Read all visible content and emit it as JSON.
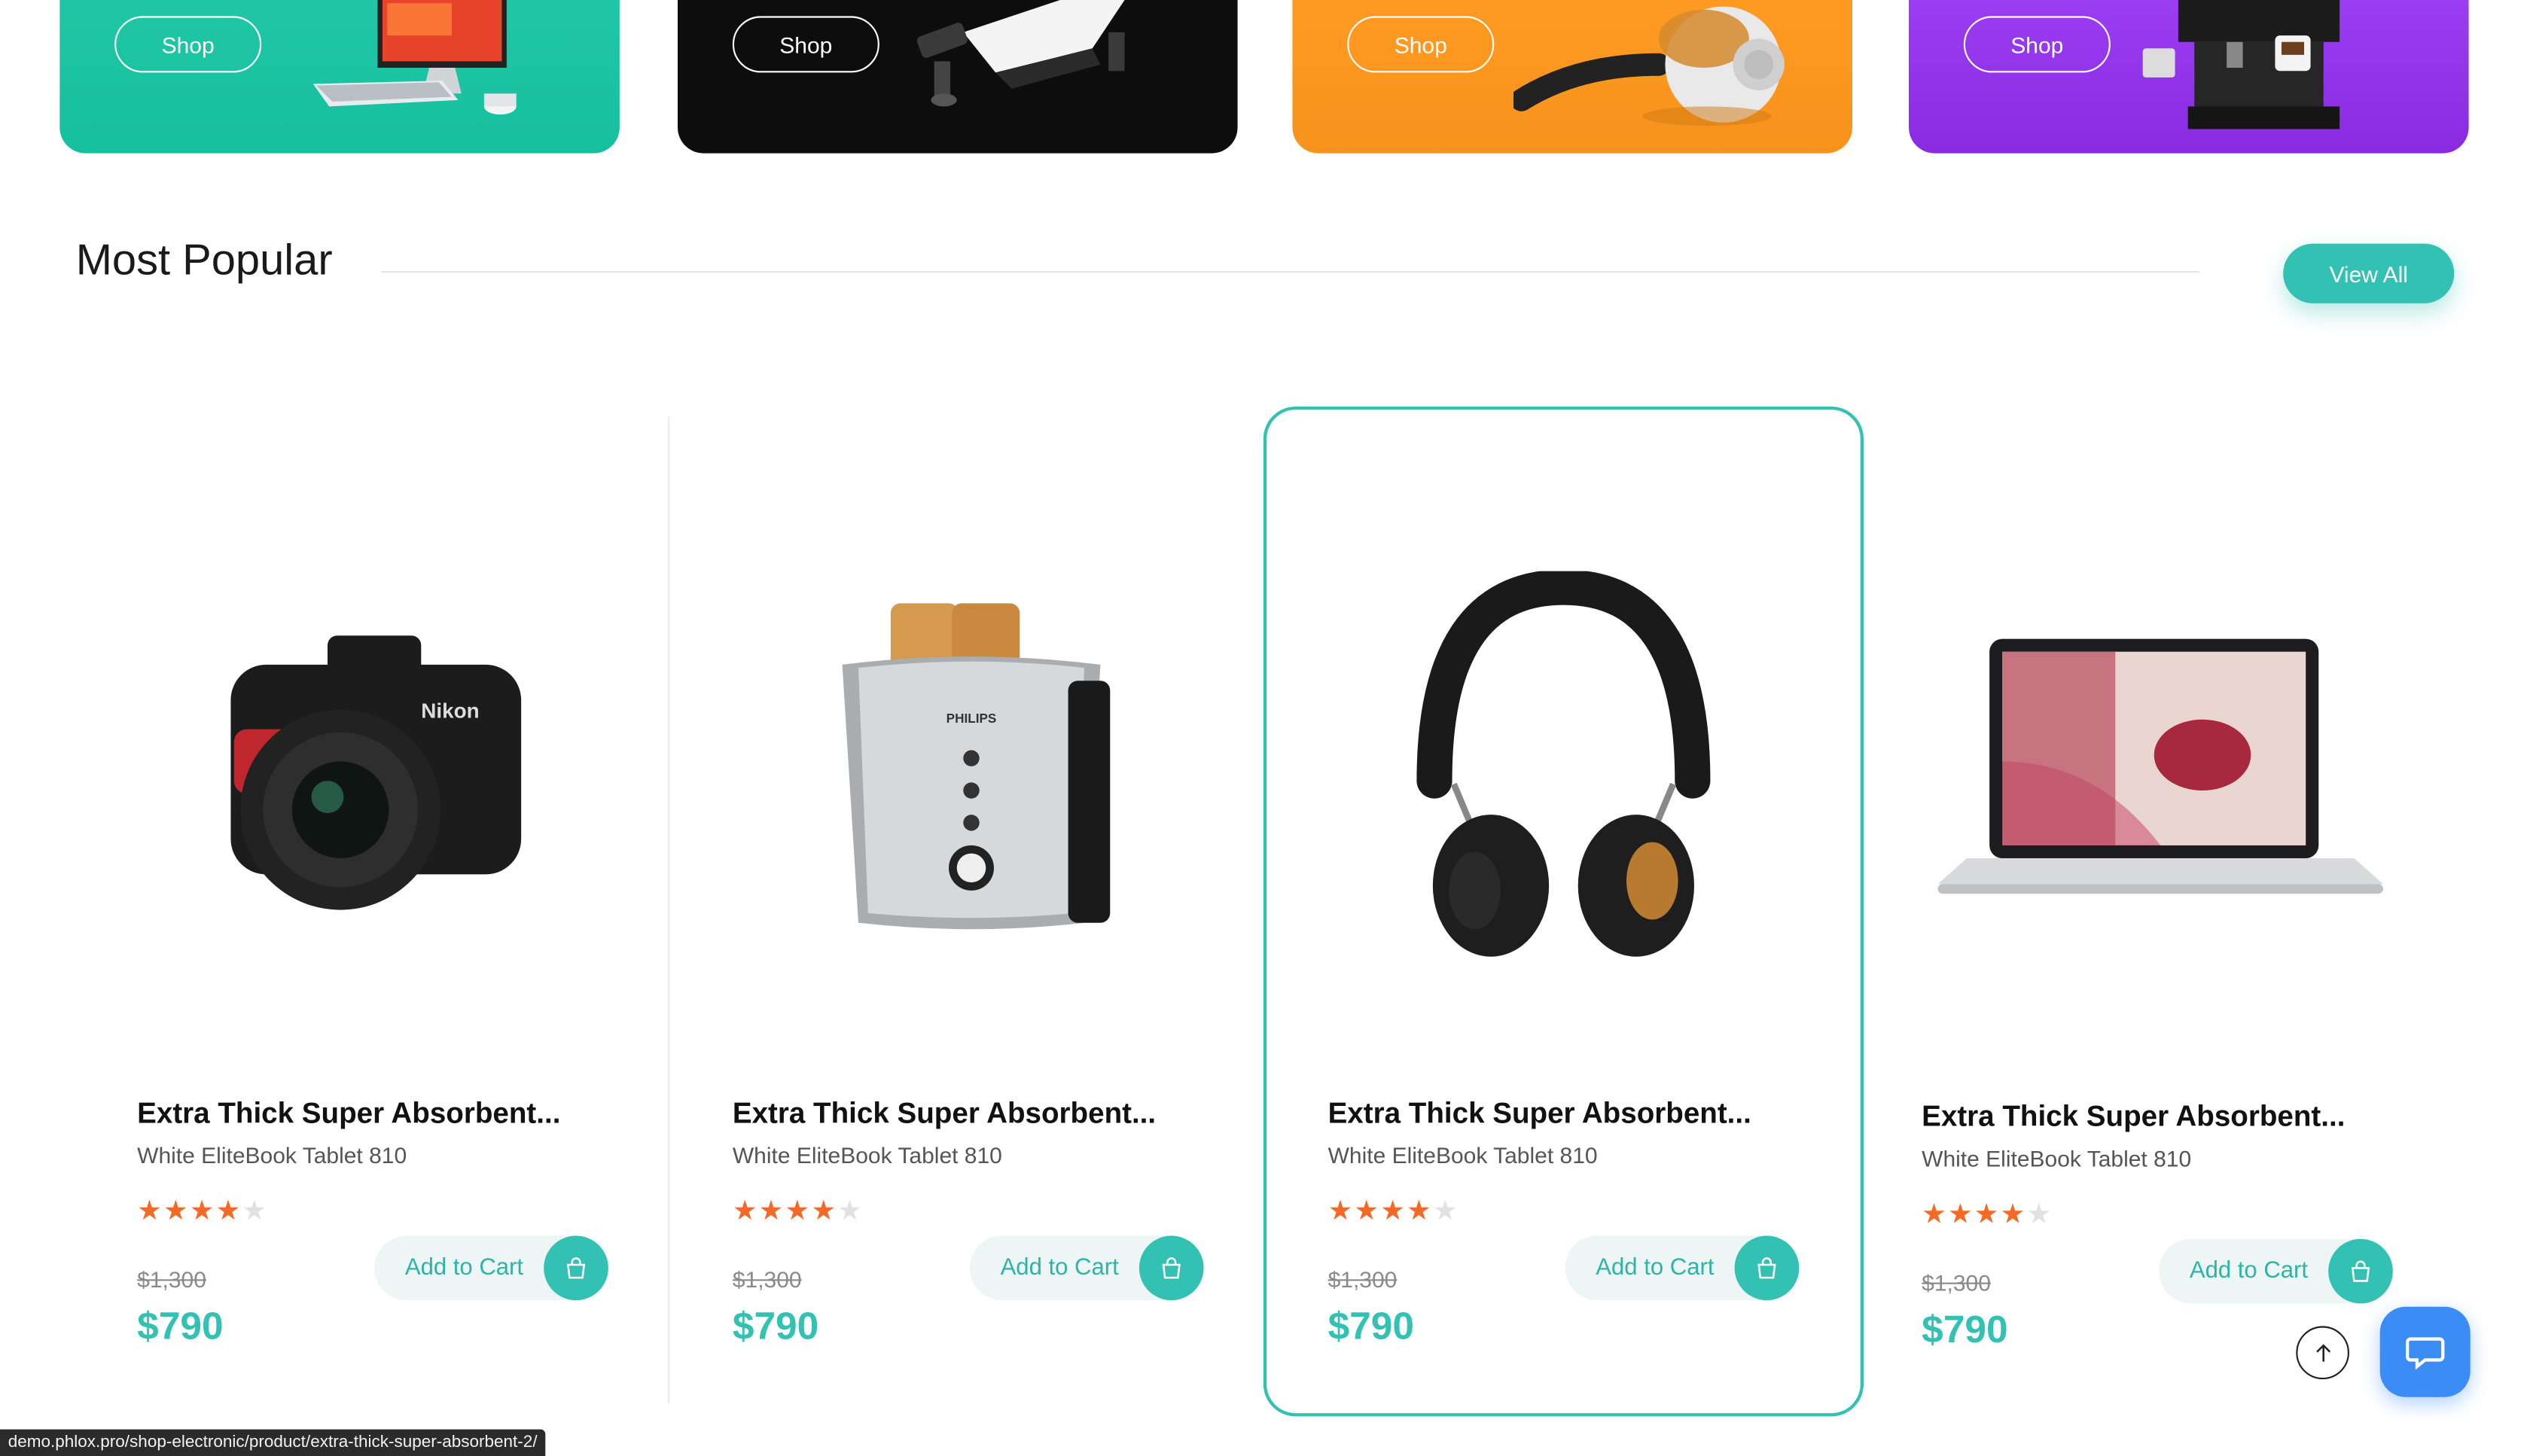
{
  "banners": [
    {
      "button_label": "Shop",
      "color": "#1fc7a6",
      "art": "desktop-computer"
    },
    {
      "button_label": "Shop",
      "color": "#0d0d0d",
      "art": "drone"
    },
    {
      "button_label": "Shop",
      "color": "#f7931c",
      "art": "vacuum-cleaner"
    },
    {
      "button_label": "Shop",
      "color": "#8a2be2",
      "art": "coffee-machine"
    }
  ],
  "section": {
    "title": "Most Popular",
    "view_all_label": "View All"
  },
  "products": [
    {
      "title": "Extra Thick Super Absorbent...",
      "subtitle": "White EliteBook Tablet 810",
      "rating": 4,
      "rating_max": 5,
      "old_price": "$1,300",
      "price": "$790",
      "cart_label": "Add to Cart",
      "image": "nikon-camera"
    },
    {
      "title": "Extra Thick Super Absorbent...",
      "subtitle": "White EliteBook Tablet 810",
      "rating": 4,
      "rating_max": 5,
      "old_price": "$1,300",
      "price": "$790",
      "cart_label": "Add to Cart",
      "image": "philips-toaster",
      "brand_text": "PHILIPS"
    },
    {
      "title": "Extra Thick Super Absorbent...",
      "subtitle": "White EliteBook Tablet 810",
      "rating": 4,
      "rating_max": 5,
      "old_price": "$1,300",
      "price": "$790",
      "cart_label": "Add to Cart",
      "image": "headphones",
      "highlighted": true
    },
    {
      "title": "Extra Thick Super Absorbent...",
      "subtitle": "White EliteBook Tablet 810",
      "rating": 4,
      "rating_max": 5,
      "old_price": "$1,300",
      "price": "$790",
      "cart_label": "Add to Cart",
      "image": "laptop"
    }
  ],
  "camera_brand": "Nikon",
  "icons": {
    "cart": "shopping-bag-icon",
    "scroll_top": "arrow-up-icon",
    "chat": "chat-bubble-icon"
  },
  "colors": {
    "accent": "#33c1b3",
    "star": "#f26a25",
    "chat": "#3b8cf5"
  },
  "status_bar": {
    "url": "demo.phlox.pro/shop-electronic/product/extra-thick-super-absorbent-2/"
  }
}
